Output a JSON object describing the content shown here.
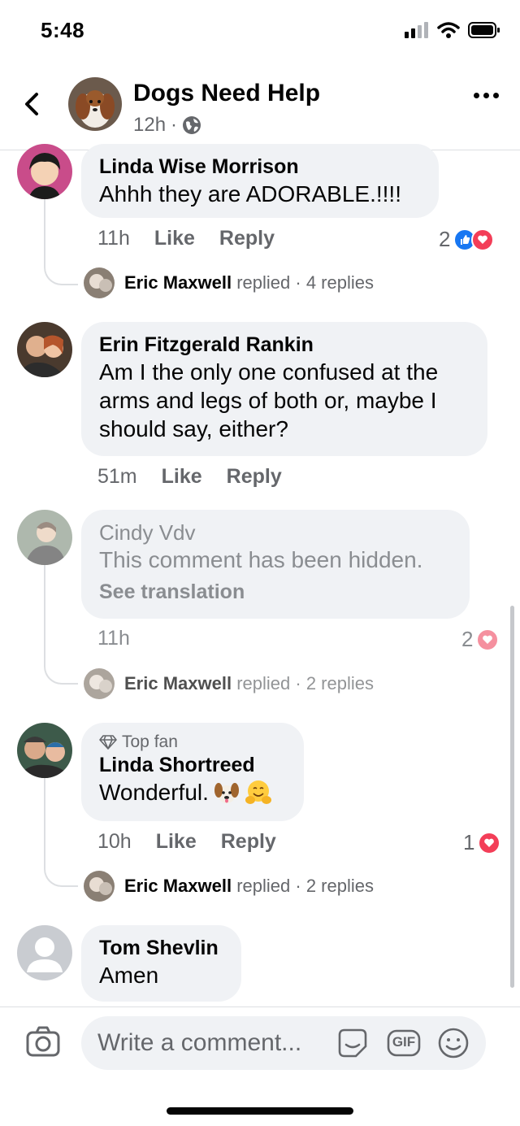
{
  "status_bar": {
    "time": "5:48"
  },
  "header": {
    "page_name": "Dogs Need Help",
    "time_ago": "12h",
    "separator": "·"
  },
  "comments": [
    {
      "name": "Linda Wise Morrison",
      "text": "Ahhh they are ADORABLE.!!!!",
      "time": "11h",
      "like_label": "Like",
      "reply_label": "Reply",
      "reaction_count": "2",
      "replied_by": "Eric Maxwell",
      "replied_suffix": "replied",
      "replies": "· 4 replies"
    },
    {
      "name": "Erin Fitzgerald Rankin",
      "text_lines": [
        "Am I the only one confused at the",
        "arms and legs of both or, maybe I",
        "should say, either?"
      ],
      "time": "51m",
      "like_label": "Like",
      "reply_label": "Reply"
    },
    {
      "name": "Cindy Vdv",
      "text": "This comment has been hidden.",
      "see_translation": "See translation",
      "time": "11h",
      "reaction_count": "2",
      "replied_by": "Eric Maxwell",
      "replied_suffix": "replied",
      "replies": "· 2 replies"
    },
    {
      "badge": "Top fan",
      "name": "Linda Shortreed",
      "text": "Wonderful.",
      "time": "10h",
      "like_label": "Like",
      "reply_label": "Reply",
      "reaction_count": "1",
      "replied_by": "Eric Maxwell",
      "replied_suffix": "replied",
      "replies": "· 2 replies"
    },
    {
      "name": "Tom Shevlin",
      "text": "Amen"
    }
  ],
  "composer": {
    "placeholder": "Write a comment...",
    "gif_label": "GIF"
  },
  "colors": {
    "like_blue": "#1877f2",
    "love_red": "#f33e58",
    "bubble_bg": "#f0f2f5",
    "secondary_text": "#65676b"
  }
}
